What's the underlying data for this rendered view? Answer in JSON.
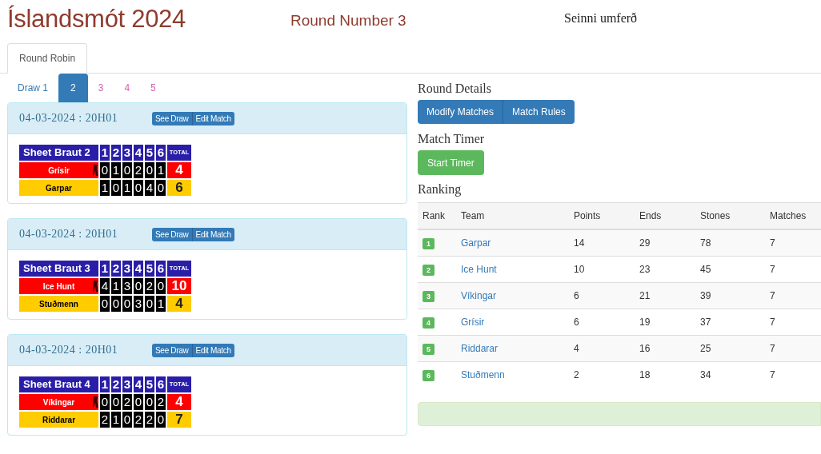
{
  "header": {
    "title": "Íslandsmót 2024",
    "round": "Round Number 3",
    "subtitle": "Seinni umferð"
  },
  "tabs": [
    {
      "label": "Round Robin",
      "selected": true
    }
  ],
  "draws": [
    {
      "label": "Draw 1",
      "selected": false
    },
    {
      "label": "2",
      "selected": true
    },
    {
      "label": "3",
      "selected": false
    },
    {
      "label": "4",
      "selected": false
    },
    {
      "label": "5",
      "selected": false
    }
  ],
  "matches": [
    {
      "datetime": "04-03-2024 : 20H01",
      "buttons": [
        "See Draw",
        "Edit Match"
      ],
      "sheet": "Sheet Braut 2",
      "ends": [
        "1",
        "2",
        "3",
        "4",
        "5",
        "6"
      ],
      "total_label": "TOTAL",
      "teams": [
        {
          "name": "Grísir",
          "color": "#ff0000",
          "hammer": true,
          "scores": [
            "0",
            "1",
            "0",
            "2",
            "0",
            "1"
          ],
          "total": "4"
        },
        {
          "name": "Garpar",
          "color": "#ffcc00",
          "hammer": false,
          "scores": [
            "1",
            "0",
            "1",
            "0",
            "4",
            "0"
          ],
          "total": "6"
        }
      ]
    },
    {
      "datetime": "04-03-2024 : 20H01",
      "buttons": [
        "See Draw",
        "Edit Match"
      ],
      "sheet": "Sheet Braut 3",
      "ends": [
        "1",
        "2",
        "3",
        "4",
        "5",
        "6"
      ],
      "total_label": "TOTAL",
      "teams": [
        {
          "name": "Ice Hunt",
          "color": "#ff0000",
          "hammer": true,
          "scores": [
            "4",
            "1",
            "3",
            "0",
            "2",
            "0"
          ],
          "total": "10"
        },
        {
          "name": "Stuðmenn",
          "color": "#ffcc00",
          "hammer": false,
          "scores": [
            "0",
            "0",
            "0",
            "3",
            "0",
            "1"
          ],
          "total": "4"
        }
      ]
    },
    {
      "datetime": "04-03-2024 : 20H01",
      "buttons": [
        "See Draw",
        "Edit Match"
      ],
      "sheet": "Sheet Braut 4",
      "ends": [
        "1",
        "2",
        "3",
        "4",
        "5",
        "6"
      ],
      "total_label": "TOTAL",
      "teams": [
        {
          "name": "Víkingar",
          "color": "#ff0000",
          "hammer": true,
          "scores": [
            "0",
            "0",
            "2",
            "0",
            "0",
            "2"
          ],
          "total": "4"
        },
        {
          "name": "Riddarar",
          "color": "#ffcc00",
          "hammer": false,
          "scores": [
            "2",
            "1",
            "0",
            "2",
            "2",
            "0"
          ],
          "total": "7"
        }
      ]
    }
  ],
  "details": {
    "title": "Round Details",
    "buttons": [
      "Modify Matches",
      "Match Rules"
    ],
    "timer_title": "Match Timer",
    "timer_button": "Start Timer",
    "ranking_title": "Ranking",
    "ranking": {
      "columns": [
        "Rank",
        "Team",
        "Points",
        "Ends",
        "Stones",
        "Matches"
      ],
      "rows": [
        {
          "rank": "1",
          "team": "Garpar",
          "points": "14",
          "ends": "29",
          "stones": "78",
          "matches": "7"
        },
        {
          "rank": "2",
          "team": "Ice Hunt",
          "points": "10",
          "ends": "23",
          "stones": "45",
          "matches": "7"
        },
        {
          "rank": "3",
          "team": "Víkingar",
          "points": "6",
          "ends": "21",
          "stones": "39",
          "matches": "7"
        },
        {
          "rank": "4",
          "team": "Grísir",
          "points": "6",
          "ends": "19",
          "stones": "37",
          "matches": "7"
        },
        {
          "rank": "5",
          "team": "Riddarar",
          "points": "4",
          "ends": "16",
          "stones": "25",
          "matches": "7"
        },
        {
          "rank": "6",
          "team": "Stuðmenn",
          "points": "2",
          "ends": "18",
          "stones": "34",
          "matches": "7"
        }
      ]
    },
    "alert": {
      "kind": "success"
    }
  }
}
